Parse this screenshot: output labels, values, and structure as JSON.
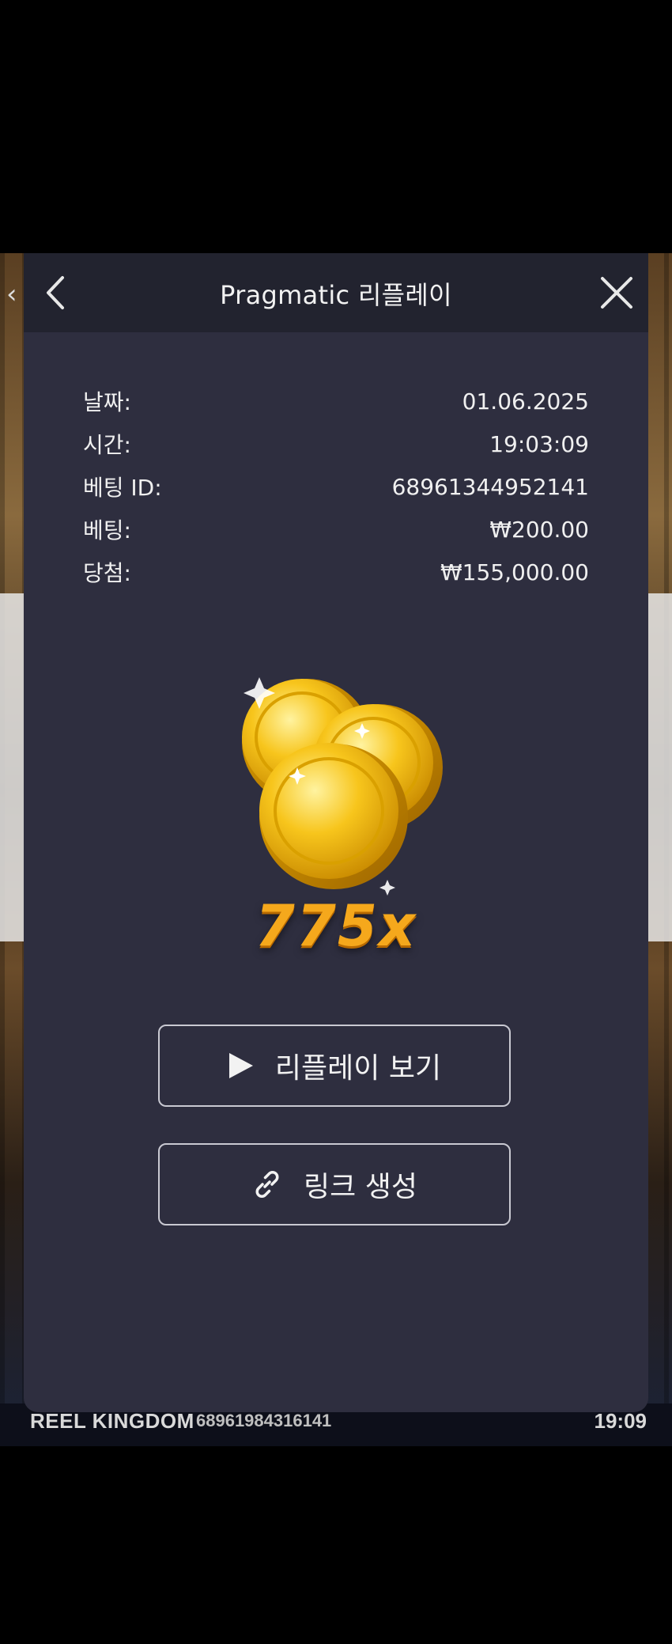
{
  "background_game": {
    "back_glyph": "‹",
    "game_name": "REEL KINGDOM",
    "round_id": "68961984316141",
    "time": "19:09"
  },
  "modal": {
    "title": "Pragmatic 리플레이",
    "back_icon": "chevron-left-icon",
    "close_icon": "close-icon",
    "details": [
      {
        "label": "날짜:",
        "value": "01.06.2025"
      },
      {
        "label": "시간:",
        "value": "19:03:09"
      },
      {
        "label": "베팅 ID:",
        "value": "68961344952141"
      },
      {
        "label": "베팅:",
        "value": "₩200.00"
      },
      {
        "label": "당첨:",
        "value": "₩155,000.00"
      }
    ],
    "win_icon": "gold-coins-icon",
    "multiplier": "775x",
    "buttons": {
      "replay_label": "리플레이 보기",
      "replay_icon": "play-icon",
      "link_label": "링크 생성",
      "link_icon": "link-icon"
    }
  },
  "colors": {
    "modal_bg": "#2e2e3f",
    "header_bg": "#22232f",
    "multiplier": "#f5a81c",
    "coin": "#f7c51c"
  }
}
